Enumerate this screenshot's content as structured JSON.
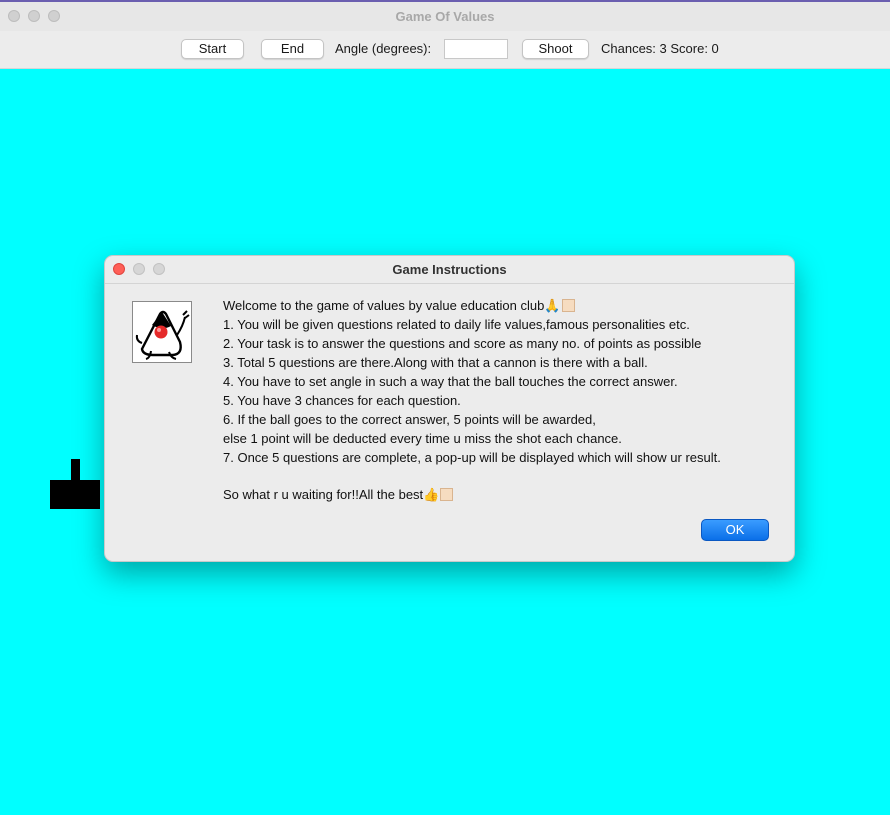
{
  "window": {
    "title": "Game Of Values"
  },
  "toolbar": {
    "start_label": "Start",
    "end_label": "End",
    "angle_label": "Angle (degrees):",
    "angle_value": "",
    "shoot_label": "Shoot",
    "status": "Chances: 3 Score: 0"
  },
  "canvas": {
    "background": "#00ffff",
    "cannon_color": "#000000"
  },
  "dialog": {
    "title": "Game Instructions",
    "icon": "java-duke-icon",
    "lines": [
      "Welcome to the game of values by value education club🙏",
      "1. You will be given questions related to daily life values,famous personalities etc.",
      "2. Your task is to answer the questions and score as many no. of points as possible",
      "3. Total 5 questions are there.Along with that a cannon is there with a ball.",
      "4. You have to set angle in such a way that the ball touches the correct answer.",
      "5. You have 3 chances for each question.",
      "6. If the ball goes to the correct answer, 5 points will be awarded,",
      "else 1 point will be deducted every time u miss the shot each chance.",
      "7. Once 5 questions are complete, a pop-up will be displayed which will show ur result."
    ],
    "closing": "So what r u waiting for!!All the best👍",
    "ok_label": "OK",
    "ok_color": "#0a6fe8"
  }
}
